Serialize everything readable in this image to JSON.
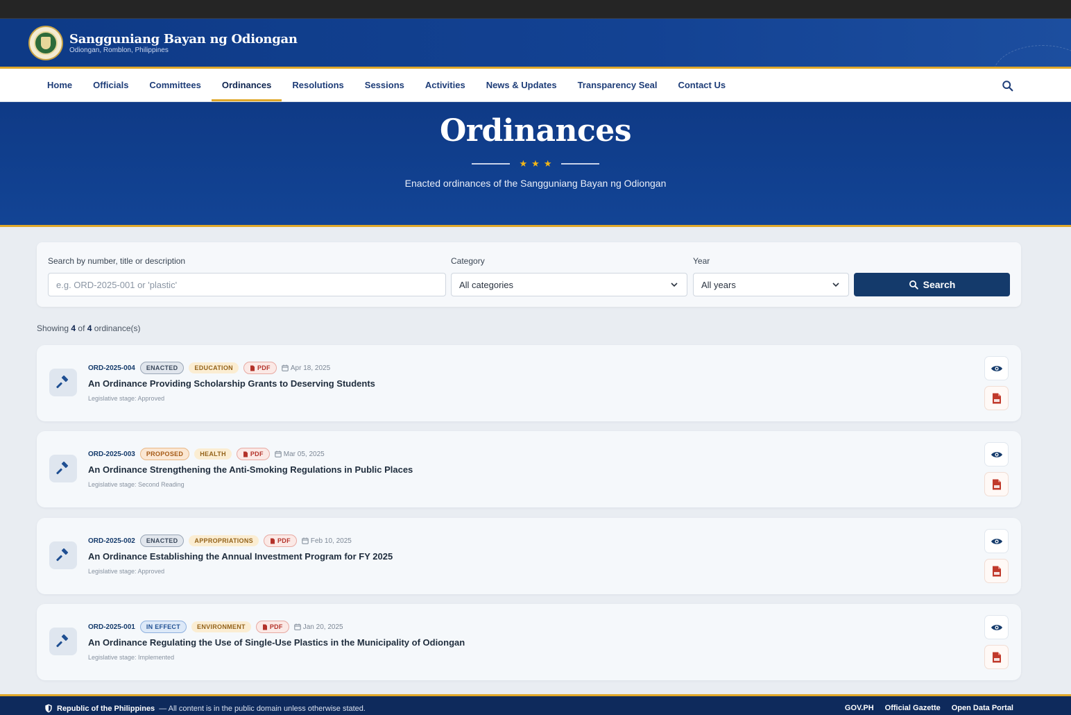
{
  "site": {
    "title": "Sangguniang Bayan ng Odiongan",
    "subtitle": "Odiongan, Romblon, Philippines"
  },
  "nav": {
    "items": [
      "Home",
      "Officials",
      "Committees",
      "Ordinances",
      "Resolutions",
      "Sessions",
      "Activities",
      "News & Updates",
      "Transparency Seal",
      "Contact Us"
    ],
    "active": "Ordinances"
  },
  "hero": {
    "title": "Ordinances",
    "stars": "★★★",
    "subtitle": "Enacted ordinances of the Sangguniang Bayan ng Odiongan"
  },
  "filters": {
    "search_label": "Search by number, title or description",
    "search_placeholder": "e.g. ORD-2025-001 or 'plastic'",
    "category_label": "Category",
    "category_value": "All categories",
    "year_label": "Year",
    "year_value": "All years",
    "search_button": "Search"
  },
  "results": {
    "prefix": "Showing",
    "shown": "4",
    "of": "of",
    "total": "4",
    "suffix": "ordinance(s)"
  },
  "ordinances": [
    {
      "number": "ORD-2025-004",
      "status": "ENACTED",
      "category": "EDUCATION",
      "pdf": "PDF",
      "date": "Apr 18, 2025",
      "title": "An Ordinance Providing Scholarship Grants to Deserving Students",
      "stage": "Legislative stage: Approved"
    },
    {
      "number": "ORD-2025-003",
      "status": "PROPOSED",
      "category": "HEALTH",
      "pdf": "PDF",
      "date": "Mar 05, 2025",
      "title": "An Ordinance Strengthening the Anti-Smoking Regulations in Public Places",
      "stage": "Legislative stage: Second Reading"
    },
    {
      "number": "ORD-2025-002",
      "status": "ENACTED",
      "category": "APPROPRIATIONS",
      "pdf": "PDF",
      "date": "Feb 10, 2025",
      "title": "An Ordinance Establishing the Annual Investment Program for FY 2025",
      "stage": "Legislative stage: Approved"
    },
    {
      "number": "ORD-2025-001",
      "status": "IN EFFECT",
      "category": "ENVIRONMENT",
      "pdf": "PDF",
      "date": "Jan 20, 2025",
      "title": "An Ordinance Regulating the Use of Single-Use Plastics in the Municipality of Odiongan",
      "stage": "Legislative stage: Implemented"
    }
  ],
  "footer": {
    "country": "Republic of the Philippines",
    "notice": "— All content is in the public domain unless otherwise stated.",
    "links": [
      "GOV.PH",
      "Official Gazette",
      "Open Data Portal"
    ]
  },
  "colors": {
    "primary": "#0f3a86",
    "accent": "#e0a82a",
    "button": "#143a6b"
  }
}
